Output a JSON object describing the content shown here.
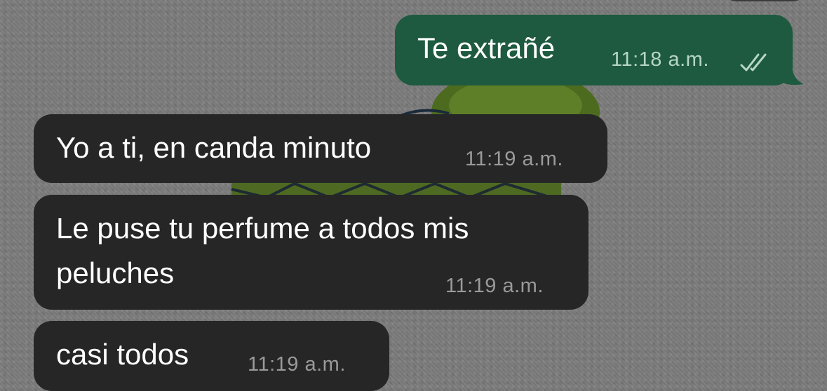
{
  "chat": {
    "messages": [
      {
        "direction": "outgoing",
        "text": "Te extrañé",
        "time": "11:18 a.m.",
        "status_icon": "double-check-icon"
      },
      {
        "direction": "incoming",
        "text": "Yo a ti, en canda minuto",
        "time": "11:19 a.m."
      },
      {
        "direction": "incoming",
        "text": "Le puse tu perfume a todos mis\npeluches",
        "time": "11:19 a.m."
      },
      {
        "direction": "incoming",
        "text": "casi todos",
        "time": "11:19 a.m."
      }
    ]
  },
  "colors": {
    "outgoing_bubble": "#1e5a3f",
    "incoming_bubble": "#262626",
    "background": "#7b7b7b"
  }
}
